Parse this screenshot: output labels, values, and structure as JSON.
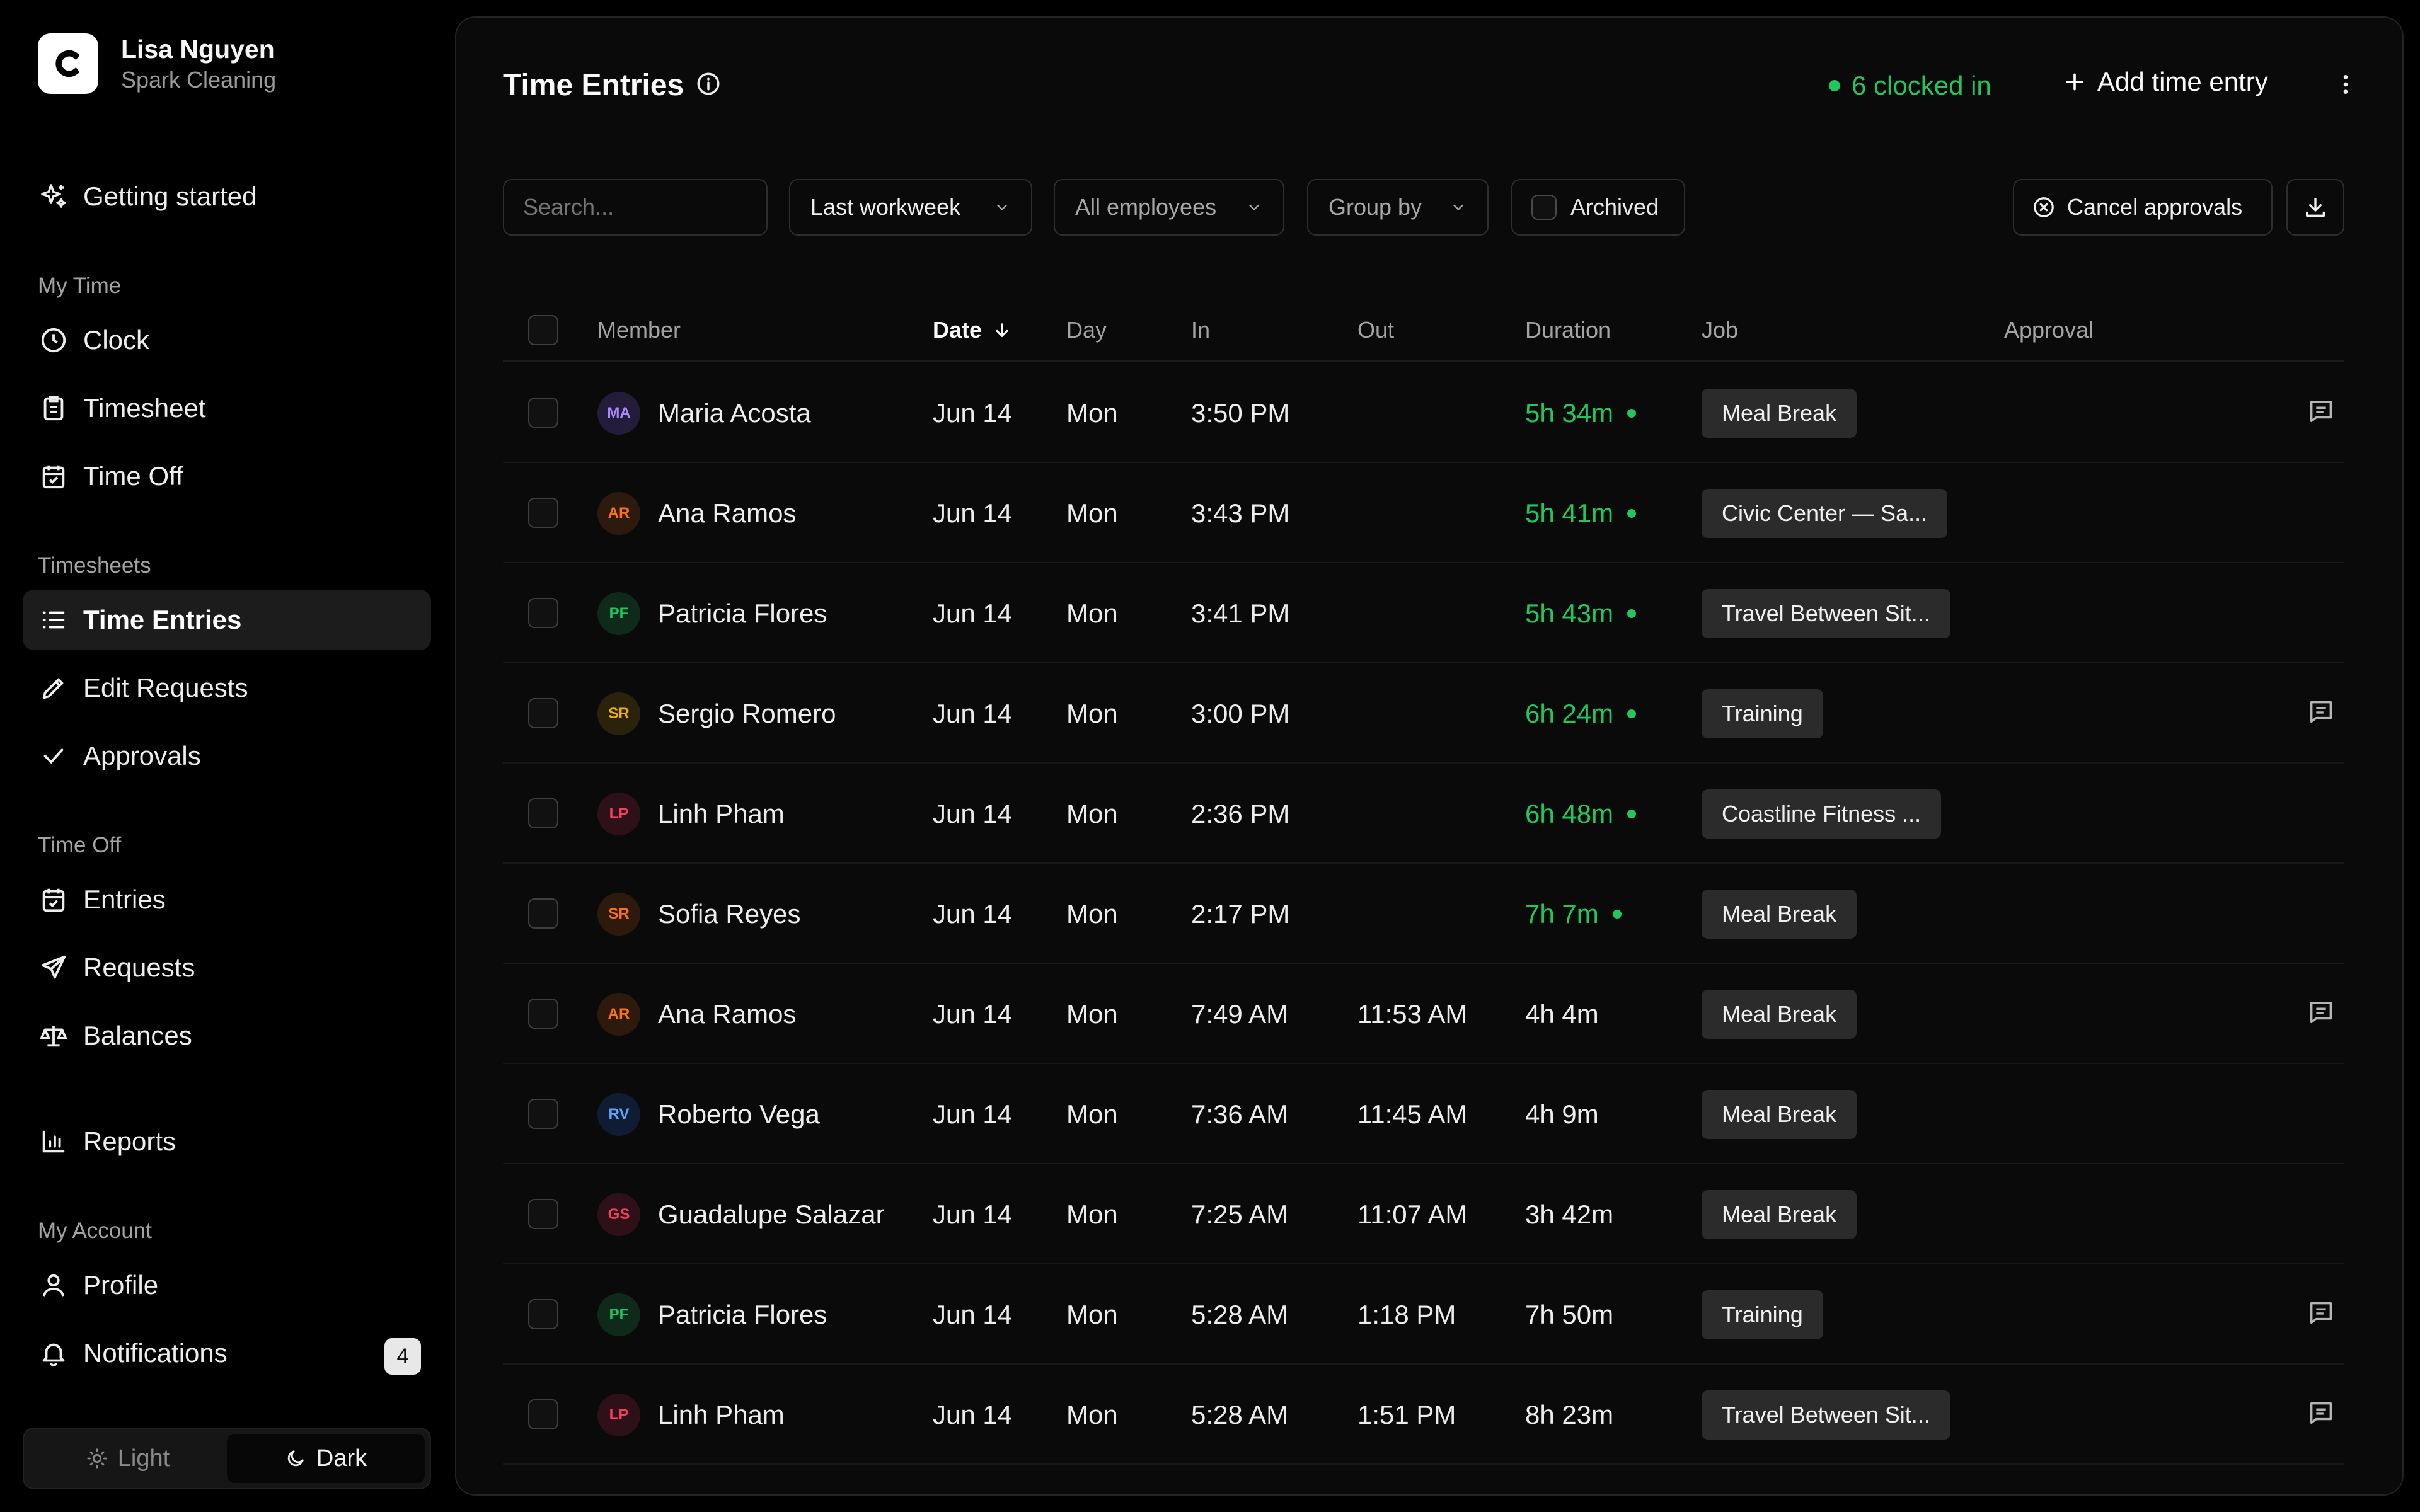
{
  "profile": {
    "name": "Lisa Nguyen",
    "org": "Spark Cleaning"
  },
  "nav": {
    "getting_started": "Getting started",
    "my_time": {
      "section": "My Time",
      "clock": "Clock",
      "timesheet": "Timesheet",
      "time_off": "Time Off"
    },
    "timesheets": {
      "section": "Timesheets",
      "time_entries": "Time Entries",
      "edit_requests": "Edit Requests",
      "approvals": "Approvals"
    },
    "time_off": {
      "section": "Time Off",
      "entries": "Entries",
      "requests": "Requests",
      "balances": "Balances"
    },
    "reports": "Reports",
    "my_account": {
      "section": "My Account",
      "profile": "Profile",
      "notifications": "Notifications",
      "notifications_count": "4"
    }
  },
  "theme": {
    "light": "Light",
    "dark": "Dark",
    "selected": "Dark"
  },
  "header": {
    "title": "Time Entries",
    "clocked_in": "6 clocked in",
    "add_label": "Add time entry"
  },
  "filters": {
    "search_placeholder": "Search...",
    "range": "Last workweek",
    "employees": "All employees",
    "group_by": "Group by",
    "archived": "Archived",
    "cancel_approvals": "Cancel approvals"
  },
  "columns": {
    "member": "Member",
    "date": "Date",
    "day": "Day",
    "in": "In",
    "out": "Out",
    "duration": "Duration",
    "job": "Job",
    "approval": "Approval"
  },
  "colors": {
    "accent_green": "#22c55e",
    "background": "#0a0a0a"
  },
  "rows": [
    {
      "initials": "MA",
      "name": "Maria Acosta",
      "date": "Jun 14",
      "day": "Mon",
      "in": "3:50 PM",
      "out": "",
      "duration": "5h 34m",
      "live": true,
      "job": "Meal Break",
      "note": true,
      "color": "#a78bfa",
      "bg": "#231c3a"
    },
    {
      "initials": "AR",
      "name": "Ana Ramos",
      "date": "Jun 14",
      "day": "Mon",
      "in": "3:43 PM",
      "out": "",
      "duration": "5h 41m",
      "live": true,
      "job": "Civic Center — Sa...",
      "note": false,
      "color": "#f97316",
      "bg": "#2e1a0c"
    },
    {
      "initials": "PF",
      "name": "Patricia Flores",
      "date": "Jun 14",
      "day": "Mon",
      "in": "3:41 PM",
      "out": "",
      "duration": "5h 43m",
      "live": true,
      "job": "Travel Between Sit...",
      "note": false,
      "color": "#22c55e",
      "bg": "#0f2a1a"
    },
    {
      "initials": "SR",
      "name": "Sergio Romero",
      "date": "Jun 14",
      "day": "Mon",
      "in": "3:00 PM",
      "out": "",
      "duration": "6h 24m",
      "live": true,
      "job": "Training",
      "note": true,
      "color": "#eab308",
      "bg": "#2a220a"
    },
    {
      "initials": "LP",
      "name": "Linh Pham",
      "date": "Jun 14",
      "day": "Mon",
      "in": "2:36 PM",
      "out": "",
      "duration": "6h 48m",
      "live": true,
      "job": "Coastline Fitness ...",
      "note": false,
      "color": "#f43f5e",
      "bg": "#2e1018"
    },
    {
      "initials": "SR",
      "name": "Sofia Reyes",
      "date": "Jun 14",
      "day": "Mon",
      "in": "2:17 PM",
      "out": "",
      "duration": "7h 7m",
      "live": true,
      "job": "Meal Break",
      "note": false,
      "color": "#f97316",
      "bg": "#2e1a0c"
    },
    {
      "initials": "AR",
      "name": "Ana Ramos",
      "date": "Jun 14",
      "day": "Mon",
      "in": "7:49 AM",
      "out": "11:53 AM",
      "duration": "4h 4m",
      "live": false,
      "job": "Meal Break",
      "note": true,
      "color": "#f97316",
      "bg": "#2e1a0c"
    },
    {
      "initials": "RV",
      "name": "Roberto Vega",
      "date": "Jun 14",
      "day": "Mon",
      "in": "7:36 AM",
      "out": "11:45 AM",
      "duration": "4h 9m",
      "live": false,
      "job": "Meal Break",
      "note": false,
      "color": "#60a5fa",
      "bg": "#0f1c33"
    },
    {
      "initials": "GS",
      "name": "Guadalupe Salazar",
      "date": "Jun 14",
      "day": "Mon",
      "in": "7:25 AM",
      "out": "11:07 AM",
      "duration": "3h 42m",
      "live": false,
      "job": "Meal Break",
      "note": false,
      "color": "#f43f5e",
      "bg": "#2e1018"
    },
    {
      "initials": "PF",
      "name": "Patricia Flores",
      "date": "Jun 14",
      "day": "Mon",
      "in": "5:28 AM",
      "out": "1:18 PM",
      "duration": "7h 50m",
      "live": false,
      "job": "Training",
      "note": true,
      "color": "#22c55e",
      "bg": "#0f2a1a"
    },
    {
      "initials": "LP",
      "name": "Linh Pham",
      "date": "Jun 14",
      "day": "Mon",
      "in": "5:28 AM",
      "out": "1:51 PM",
      "duration": "8h 23m",
      "live": false,
      "job": "Travel Between Sit...",
      "note": true,
      "color": "#f43f5e",
      "bg": "#2e1018"
    }
  ]
}
